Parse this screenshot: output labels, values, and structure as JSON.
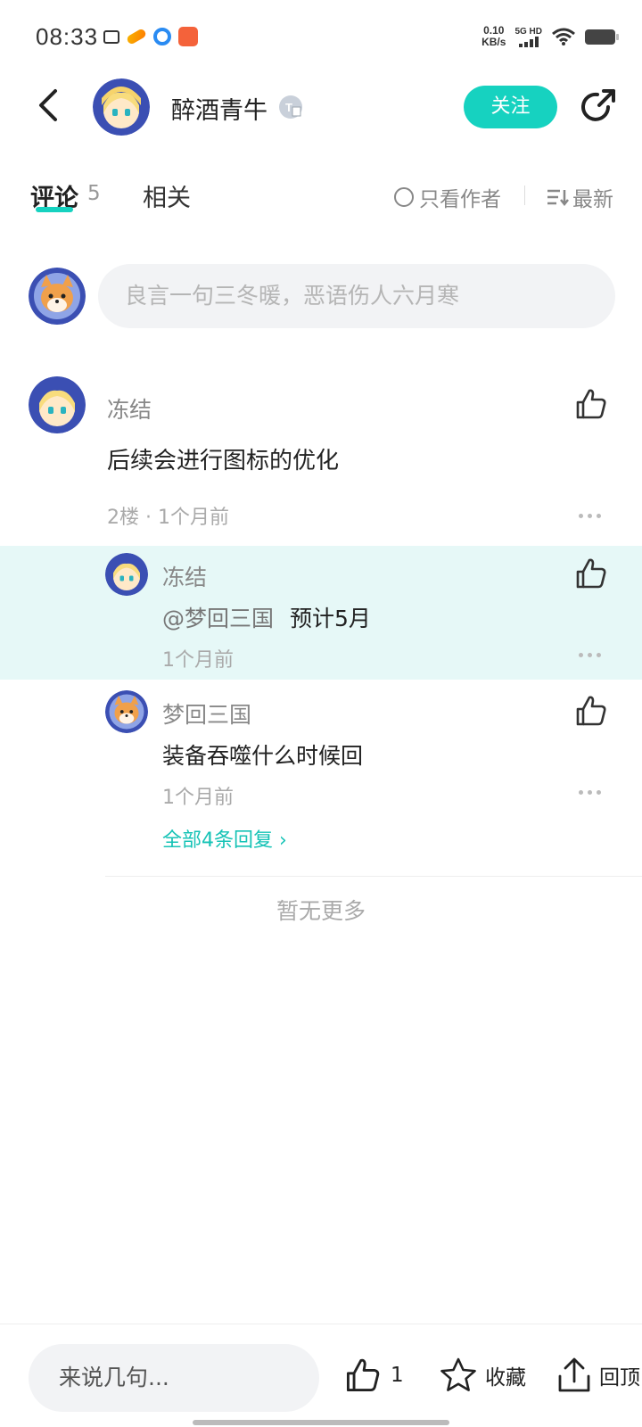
{
  "status_bar": {
    "time": "08:33",
    "net_speed_value": "0.10",
    "net_speed_unit": "KB/s",
    "network": "5G HD"
  },
  "header": {
    "author_name": "醉酒青牛",
    "follow_label": "关注"
  },
  "tabs": {
    "comments_label": "评论",
    "comments_count": "5",
    "related_label": "相关",
    "only_author_label": "只看作者",
    "sort_label": "最新"
  },
  "comment_input": {
    "placeholder": "良言一句三冬暖，恶语伤人六月寒"
  },
  "comments": [
    {
      "author": "冻结",
      "text": "后续会进行图标的优化",
      "meta": "2楼 · 1个月前",
      "replies": [
        {
          "author": "冻结",
          "mention": "@梦回三国",
          "text": "预计5月",
          "time": "1个月前"
        },
        {
          "author": "梦回三国",
          "mention": "",
          "text": "装备吞噬什么时候回",
          "time": "1个月前"
        }
      ],
      "view_all_label": "全部4条回复 ›"
    }
  ],
  "footer_note": "暂无更多",
  "bottom_bar": {
    "input_label": "来说几句...",
    "like_count": "1",
    "favorite_label": "收藏",
    "top_label": "回顶"
  },
  "colors": {
    "accent": "#16d2c0",
    "highlight_bg": "#e6f8f7",
    "link": "#16c3b6"
  }
}
